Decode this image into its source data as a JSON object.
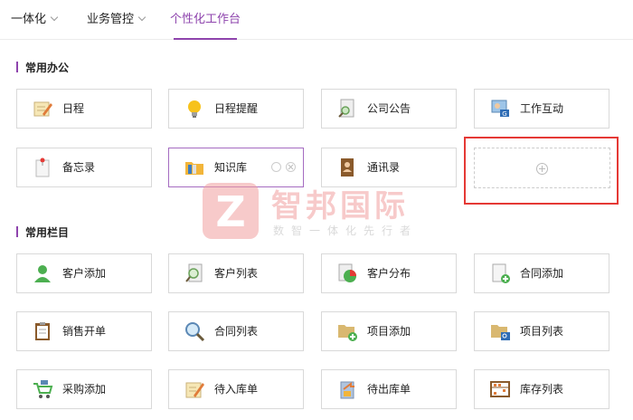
{
  "nav": {
    "items": [
      {
        "label": "一体化",
        "has_dropdown": true,
        "active": false
      },
      {
        "label": "业务管控",
        "has_dropdown": true,
        "active": false
      },
      {
        "label": "个性化工作台",
        "has_dropdown": false,
        "active": true
      }
    ]
  },
  "sections": {
    "office": {
      "title": "常用办公",
      "tiles": [
        {
          "label": "日程",
          "icon": "notepad-pencil-icon"
        },
        {
          "label": "日程提醒",
          "icon": "lightbulb-icon"
        },
        {
          "label": "公司公告",
          "icon": "document-search-icon"
        },
        {
          "label": "工作互动",
          "icon": "user-monitor-icon"
        },
        {
          "label": "备忘录",
          "icon": "pinned-note-icon"
        },
        {
          "label": "知识库",
          "icon": "folder-icon",
          "selected": true
        },
        {
          "label": "通讯录",
          "icon": "address-book-icon"
        }
      ],
      "add_tile": {
        "icon": "plus-circle-icon"
      }
    },
    "columns": {
      "title": "常用栏目",
      "tiles": [
        {
          "label": "客户添加",
          "icon": "user-add-icon"
        },
        {
          "label": "客户列表",
          "icon": "magnifier-doc-icon"
        },
        {
          "label": "客户分布",
          "icon": "pie-chart-icon"
        },
        {
          "label": "合同添加",
          "icon": "document-add-icon"
        },
        {
          "label": "销售开单",
          "icon": "clipboard-icon"
        },
        {
          "label": "合同列表",
          "icon": "magnifier-icon"
        },
        {
          "label": "项目添加",
          "icon": "folder-add-icon"
        },
        {
          "label": "项目列表",
          "icon": "folder-list-icon"
        },
        {
          "label": "采购添加",
          "icon": "cart-icon"
        },
        {
          "label": "待入库单",
          "icon": "note-pencil-icon"
        },
        {
          "label": "待出库单",
          "icon": "clipboard-arrow-icon"
        },
        {
          "label": "库存列表",
          "icon": "abacus-icon"
        }
      ]
    }
  },
  "watermark": {
    "title": "智邦国际",
    "subtitle": "数智一体化先行者",
    "logo_letter": "Z"
  },
  "colors": {
    "accent": "#8e44ad",
    "highlight": "#e53935"
  }
}
